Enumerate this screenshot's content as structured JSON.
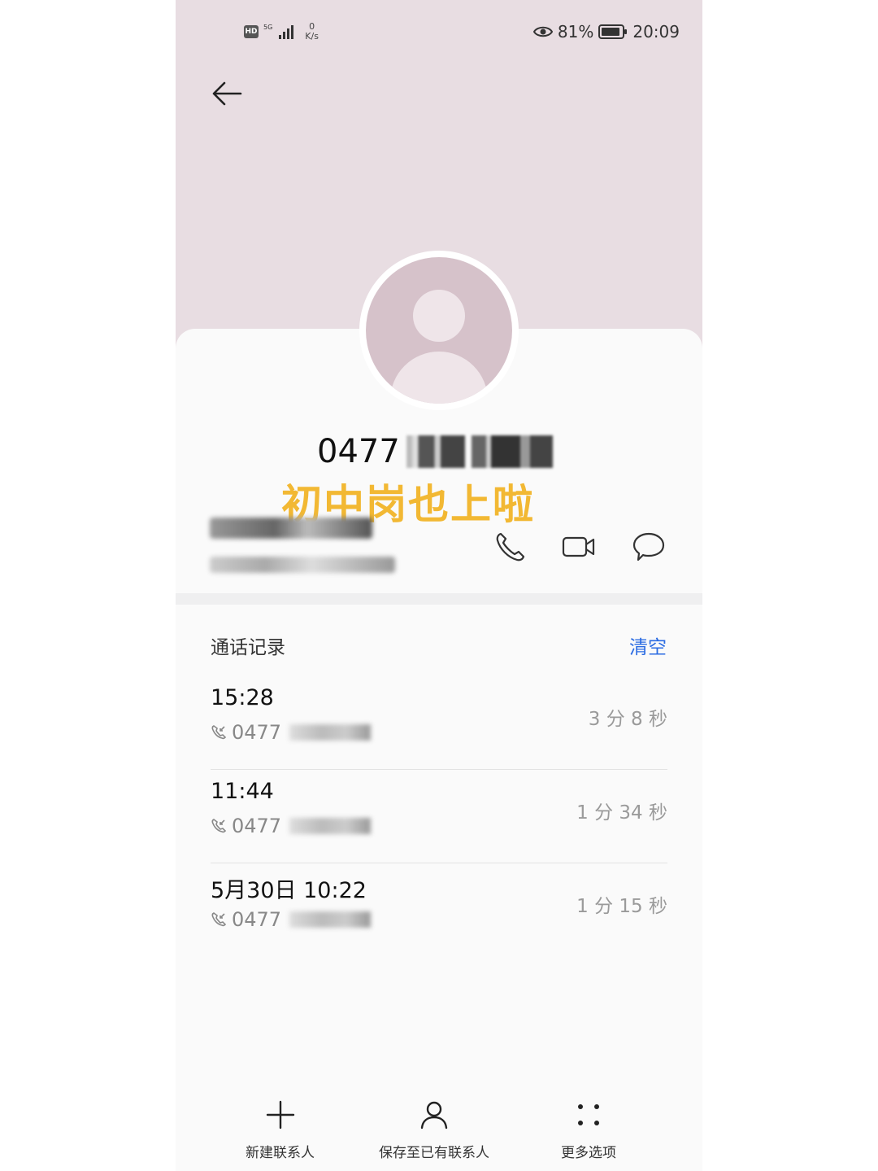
{
  "status_bar": {
    "hd_badge": "HD",
    "network_type": "5G",
    "speed_value": "0",
    "speed_unit": "K/s",
    "battery": "81%",
    "time": "20:09"
  },
  "contact": {
    "number_prefix": "0477",
    "caption": "初中岗也上啦"
  },
  "call_log": {
    "title": "通话记录",
    "clear_label": "清空",
    "entries": [
      {
        "time": "15:28",
        "number": "0477",
        "duration": "3 分 8 秒"
      },
      {
        "time": "11:44",
        "number": "0477",
        "duration": "1 分 34 秒"
      },
      {
        "time": "5月30日 10:22",
        "number": "0477",
        "duration": "1 分 15 秒"
      }
    ]
  },
  "bottom_nav": {
    "new_contact": "新建联系人",
    "save_existing": "保存至已有联系人",
    "more_options": "更多选项"
  },
  "icons": {
    "back": "arrow-left-icon",
    "call": "phone-icon",
    "video": "video-camera-icon",
    "message": "chat-bubble-icon",
    "add": "plus-icon",
    "person": "person-icon",
    "more": "dots-grid-icon"
  },
  "colors": {
    "header_bg": "#e8dde2",
    "avatar": "#d6c2ca",
    "caption": "#f2b833",
    "link": "#2a6be2"
  }
}
